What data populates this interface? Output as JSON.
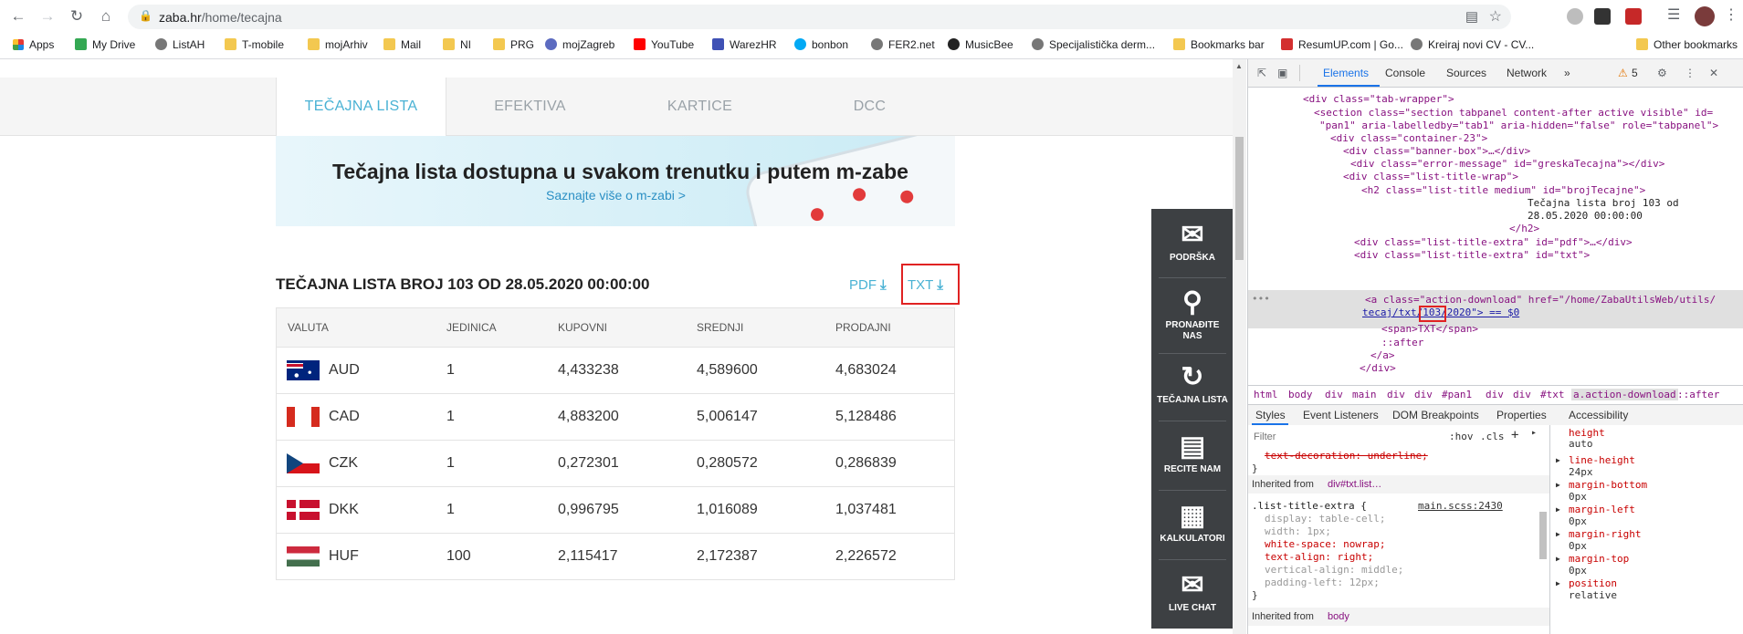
{
  "browser": {
    "url_host": "zaba.hr",
    "url_path": "/home/tecajna",
    "bookmarks": [
      "Apps",
      "My Drive",
      "ListAH",
      "T-mobile",
      "mojArhiv",
      "Mail",
      "NI",
      "PRG",
      "mojZagreb",
      "YouTube",
      "WarezHR",
      "bonbon",
      "FER2.net",
      "MusicBee",
      "Specijalistička derm...",
      "Bookmarks bar",
      "ResumUP.com | Go...",
      "Kreiraj novi CV - CV...",
      "Other bookmarks"
    ]
  },
  "page": {
    "tabs": [
      "TEČAJNA LISTA",
      "EFEKTIVA",
      "KARTICE",
      "DCC"
    ],
    "banner_title": "Tečajna lista dostupna u svakom trenutku i putem m-zabe",
    "banner_link": "Saznajte više o m-zabi >",
    "list_title": "TEČAJNA LISTA BROJ 103 OD 28.05.2020 00:00:00",
    "pdf_label": "PDF",
    "txt_label": "TXT",
    "table": {
      "headers": [
        "VALUTA",
        "JEDINICA",
        "KUPOVNI",
        "SREDNJI",
        "PRODAJNI"
      ],
      "rows": [
        {
          "valuta": "AUD",
          "jedinica": "1",
          "kupovni": "4,433238",
          "srednji": "4,589600",
          "prodajni": "4,683024"
        },
        {
          "valuta": "CAD",
          "jedinica": "1",
          "kupovni": "4,883200",
          "srednji": "5,006147",
          "prodajni": "5,128486"
        },
        {
          "valuta": "CZK",
          "jedinica": "1",
          "kupovni": "0,272301",
          "srednji": "0,280572",
          "prodajni": "0,286839"
        },
        {
          "valuta": "DKK",
          "jedinica": "1",
          "kupovni": "0,996795",
          "srednji": "1,016089",
          "prodajni": "1,037481"
        },
        {
          "valuta": "HUF",
          "jedinica": "100",
          "kupovni": "2,115417",
          "srednji": "2,172387",
          "prodajni": "2,226572"
        }
      ]
    },
    "side_widget": [
      "PODRŠKA",
      "PRONAĐITE NAS",
      "TEČAJNA LISTA",
      "RECITE NAM",
      "KALKULATORI",
      "LIVE CHAT"
    ]
  },
  "devtools": {
    "tabs": [
      "Elements",
      "Console",
      "Sources",
      "Network"
    ],
    "warnings": "5",
    "lines": [
      "<div class=\"tab-wrapper\">",
      "<section class=\"section tabpanel content-after active visible\" id=",
      "\"pan1\" aria-labelledby=\"tab1\" aria-hidden=\"false\" role=\"tabpanel\">",
      "<div class=\"container-23\">",
      "<div class=\"banner-box\">…</div>",
      "<div class=\"error-message\" id=\"greskaTecajna\"></div>",
      "<div class=\"list-title-wrap\">",
      "<h2 class=\"list-title medium\" id=\"brojTecajne\">",
      "Tečajna lista broj 103 od",
      "28.05.2020 00:00:00",
      "</h2>",
      "<div class=\"list-title-extra\" id=\"pdf\">…</div>",
      "<div class=\"list-title-extra\" id=\"txt\">",
      "<a class=\"action-download\" href=\"/home/ZabaUtilsWeb/utils/",
      "tecaj/txt/103/2020\"> == $0",
      "<span>TXT</span>",
      "::after",
      "</a>",
      "</div>"
    ],
    "breadcrumbs": [
      "html",
      "body",
      "div",
      "main",
      "div",
      "div",
      "#pan1",
      "div",
      "div",
      "#txt",
      "a.action-download",
      "::after"
    ],
    "subtabs": [
      "Styles",
      "Event Listeners",
      "DOM Breakpoints",
      "Properties",
      "Accessibility"
    ],
    "filter_placeholder": "Filter",
    "hov": ":hov",
    "cls": ".cls",
    "styles": {
      "struck": "text-decoration: underline;",
      "inherited1": "Inherited from",
      "inherited1_el": "div#txt.list…",
      "selector": ".list-title-extra {",
      "source": "main.scss:2430",
      "props": [
        "display: table-cell;",
        "width: 1px;",
        "white-space: nowrap;",
        "text-align: right;",
        "vertical-align: middle;",
        "padding-left: 12px;"
      ],
      "close": "}",
      "inherited2": "Inherited from",
      "inherited2_el": "body"
    },
    "computed": [
      {
        "name": "height",
        "value": "auto"
      },
      {
        "name": "line-height",
        "value": "24px"
      },
      {
        "name": "margin-bottom",
        "value": "0px"
      },
      {
        "name": "margin-left",
        "value": "0px"
      },
      {
        "name": "margin-right",
        "value": "0px"
      },
      {
        "name": "margin-top",
        "value": "0px"
      },
      {
        "name": "position",
        "value": "relative"
      }
    ]
  }
}
